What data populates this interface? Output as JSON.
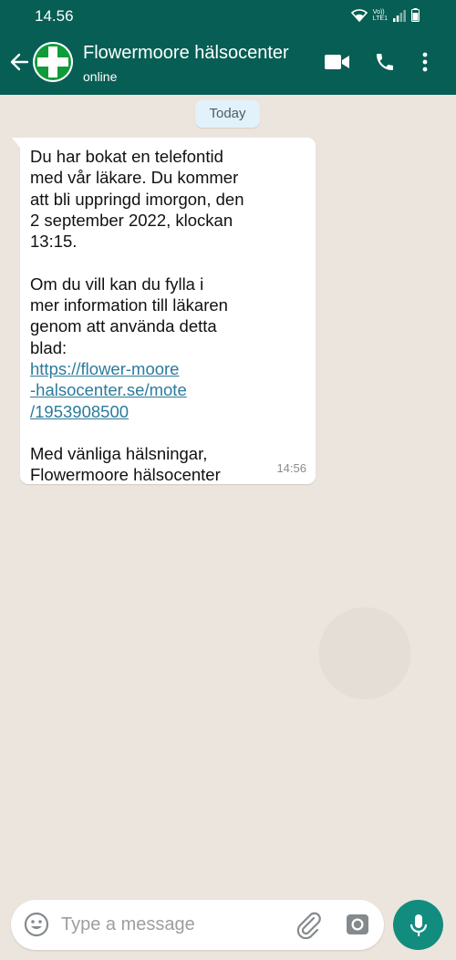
{
  "status_bar": {
    "time": "14.56",
    "volte_top": "Vo))",
    "volte_bottom": "LTE1"
  },
  "header": {
    "contact_name": "Flowermoore hälsocenter",
    "status": "online",
    "icons": [
      "back-arrow-icon",
      "avatar",
      "video-call-icon",
      "phone-icon",
      "more-options-icon"
    ]
  },
  "chat": {
    "date_chip": "Today",
    "message": {
      "lines_p1": [
        "Du har bokat en telefontid",
        "med vår läkare. Du kommer",
        "att bli uppringd imorgon, den",
        "2 september 2022, klockan",
        "13:15."
      ],
      "lines_p2": [
        "Om du vill kan du fylla i",
        "mer information till läkaren",
        "genom att använda detta",
        "blad:"
      ],
      "link_lines": [
        "https://flower-moore",
        "-halsocenter.se/mote",
        "/1953908500"
      ],
      "lines_p3": [
        "Med vänliga hälsningar,",
        "Flowermoore hälsocenter"
      ],
      "time": "14:56"
    }
  },
  "composer": {
    "placeholder": "Type a message",
    "icons": [
      "emoji-icon",
      "attach-icon",
      "camera-icon",
      "mic-icon"
    ]
  },
  "colors": {
    "header_bg": "#075e54",
    "chat_bg": "#ece5dd",
    "link": "#2b7b9c",
    "mic_button": "#128c7e",
    "logo_green": "#0f9b3a"
  }
}
